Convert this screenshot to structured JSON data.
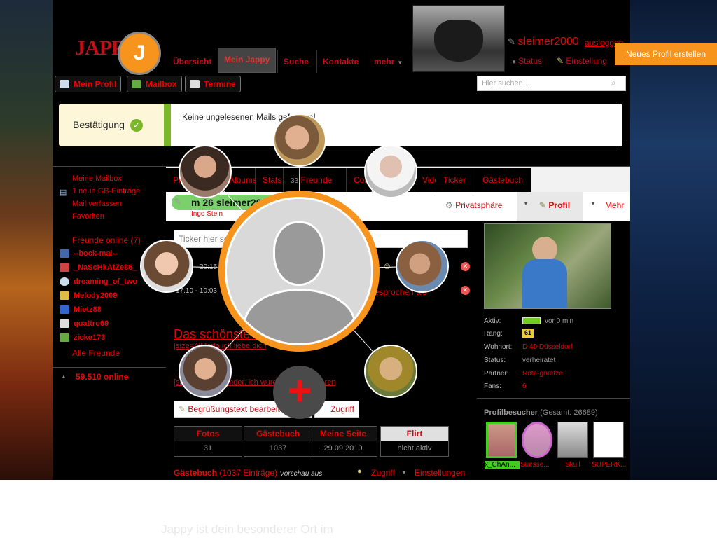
{
  "header": {
    "logo_text": "JAPPY",
    "badge_letter": "J",
    "tabs": [
      {
        "label": "Übersicht"
      },
      {
        "label": "Mein Jappy"
      },
      {
        "label": "Suche"
      },
      {
        "label": "Kontakte"
      },
      {
        "label": "mehr"
      }
    ],
    "username": "sleimer2000",
    "logout": "ausloggen",
    "status": "Status",
    "settings": "Einstellung",
    "new_profile": "Neues Profil erstellen",
    "search_placeholder": "Hier suchen ..."
  },
  "subnav": {
    "profile": "Mein Profil",
    "mailbox": "Mailbox",
    "dates": "Termine"
  },
  "notice": {
    "label": "Bestätigung",
    "text": "Keine ungelesenen Mails gefunden!"
  },
  "sidebar": {
    "links": [
      "Meine Mailbox",
      "1 neue GB-Einträge",
      "Mail verfassen",
      "Favoriten"
    ],
    "friends_header": "Freunde online (7)",
    "friends": [
      "--bock-mal--",
      "_NaScHkAtZe86_",
      "dreaming_of_two",
      "Melody2009",
      "Mietz88",
      "quattro69",
      "zicke173"
    ],
    "all_friends": "Alle Freunde",
    "online_count": "59.510 online"
  },
  "profile": {
    "tabs": [
      "Profil",
      "Albums",
      "Stats",
      "Freunde",
      "Communities",
      "Videos",
      "Ticker",
      "Gästebuch"
    ],
    "friends_count": "33",
    "name_line": "m 26 sleimer2000",
    "partner_name": "Ingo Stein",
    "privacy": "Privatsphäre",
    "profile_menu": "Profil",
    "more": "Mehr",
    "ticker_placeholder": "Ticker hier schreiben...",
    "ticker_times": [
      "20:15",
      "17.10 - 10:03"
    ],
    "ticker_fragment": "gesprochen wo",
    "headline": "Das schönste Gefühl der Welt",
    "sub_link": "[size=4]Marla ich liebe dich",
    "sender_link": "[size=1]Sexy Sender, ich würde gern rein hören",
    "greeting_btn": "Begrüßungstext bearbeiten",
    "access_btn": "Zugriff",
    "stats": [
      {
        "label": "Fotos",
        "value": "31"
      },
      {
        "label": "Gästebuch",
        "value": "1037"
      },
      {
        "label": "Meine Seite",
        "value": "29.09.2010"
      },
      {
        "label": "Flirt",
        "value": "nicht aktiv"
      }
    ],
    "guestbook": "Gästebuch",
    "guestbook_count": "(1037 Einträge)",
    "guestbook_preview": "Vorschau aus",
    "guestbook_access": "Zugriff",
    "guestbook_settings": "Einstellungen"
  },
  "info": {
    "active_label": "Aktiv:",
    "active_val": "vor 0 min",
    "rank_label": "Rang:",
    "rank_val": "61",
    "city_label": "Wohnort:",
    "city_val": "D 40 Düsseldorf",
    "status_label": "Status:",
    "status_val": "verheiratet",
    "partner_label": "Partner:",
    "partner_val": "Rote-gruetze",
    "fans_label": "Fans:",
    "fans_val": "6"
  },
  "visitors": {
    "header": "Profilbesucher",
    "total": "(Gesamt: 26689)",
    "names": [
      "x_ChAn...",
      "Suesse...",
      "Skull",
      "SUPERK..."
    ]
  },
  "footer_text": "Jappy ist dein besonderer Ort im",
  "colors": {
    "accent": "#f7941d",
    "brand_red": "#e00000",
    "bg": "#000000",
    "confirm_green": "#7ab82a"
  }
}
